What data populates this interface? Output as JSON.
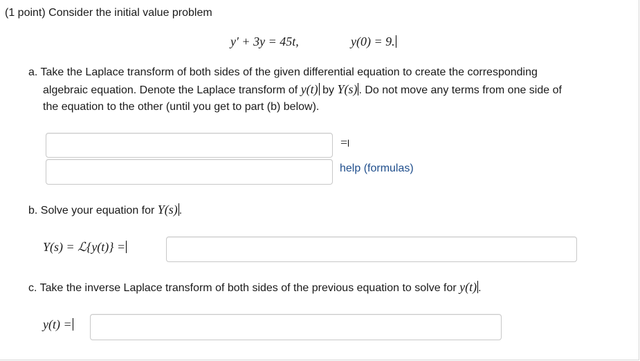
{
  "intro": "(1 point) Consider the initial value problem",
  "ode": {
    "lhs": "y′ + 3y = 45t,",
    "ic": "y(0) = 9."
  },
  "part_a": {
    "line1": "a. Take the Laplace transform of both sides of the given differential equation to create the corresponding",
    "line2_pre": "algebraic equation. Denote the Laplace transform of ",
    "line2_y": "y(t)",
    "line2_by": " by ",
    "line2_Y": "Y(s)",
    "line2_post": ". Do not move any terms from one side of",
    "line3": "the equation to the other (until you get to part (b) below).",
    "lhs_value": "",
    "rhs_value": "",
    "equals": "=",
    "help_link": "help (formulas)"
  },
  "part_b": {
    "prompt_pre": "b. Solve your equation for ",
    "prompt_Y": "Y(s)",
    "prompt_post": ".",
    "label": "Y(s) = ℒ{y(t)} =",
    "value": ""
  },
  "part_c": {
    "prompt_pre": "c. Take the inverse Laplace transform of both sides of the previous equation to solve for ",
    "prompt_y": "y(t)",
    "prompt_post": ".",
    "label": "y(t) =",
    "value": ""
  }
}
